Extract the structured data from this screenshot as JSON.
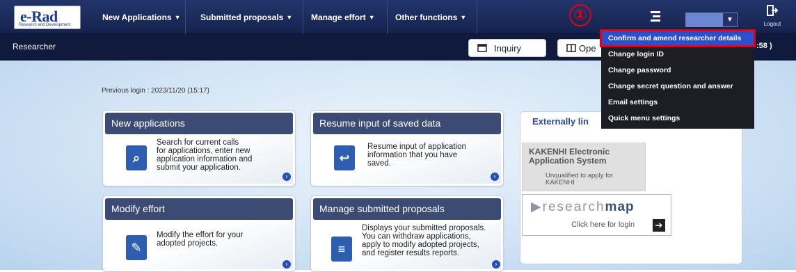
{
  "logo": {
    "main": "e-Rad",
    "sub": "Research and Development"
  },
  "nav": {
    "items": [
      {
        "label": "New Applications"
      },
      {
        "label": "Submitted proposals"
      },
      {
        "label": "Manage effort"
      },
      {
        "label": "Other functions"
      }
    ],
    "logout_label": "Logout"
  },
  "subbar": {
    "role": "Researcher",
    "inquiry_label": "Inquiry",
    "open_label": "Ope",
    "datetime_tail": ":58 )"
  },
  "annotation": {
    "marker": "①"
  },
  "user_menu": {
    "items": [
      "Confirm and amend researcher details",
      "Change login ID",
      "Change password",
      "Change secret question and answer",
      "Email settings",
      "Quick menu settings"
    ]
  },
  "main": {
    "previous_login": "Previous login : 2023/11/20 (15:17)",
    "cards": [
      {
        "title": "New applications",
        "desc": [
          "Search for current calls",
          "for applications, enter new",
          "application information and",
          "submit your application."
        ]
      },
      {
        "title": "Resume input of saved data",
        "desc": [
          "Resume input of application",
          "information that you have",
          "saved."
        ]
      },
      {
        "title": "Modify effort",
        "desc": [
          "Modify the effort for your",
          "adopted projects."
        ]
      },
      {
        "title": "Manage submitted proposals",
        "desc": [
          "Displays your submitted proposals.",
          "You can withdraw applications,",
          "apply to modify adopted projects,",
          "and register results reports."
        ]
      }
    ]
  },
  "external": {
    "title": "Externally lin",
    "kakenhi_title": [
      "KAKENHI Electronic",
      "Application System"
    ],
    "kakenhi_note": [
      "Unqualified to apply for",
      "KAKENHI"
    ],
    "researchmap_logo_a": "research",
    "researchmap_logo_b": "map",
    "researchmap_link": "Click here for login"
  },
  "colors": {
    "nav_bg": "#1c2a5c",
    "subbar_bg": "#101a3c",
    "highlight_red": "#e60012",
    "menu_active": "#2b4fcf"
  }
}
